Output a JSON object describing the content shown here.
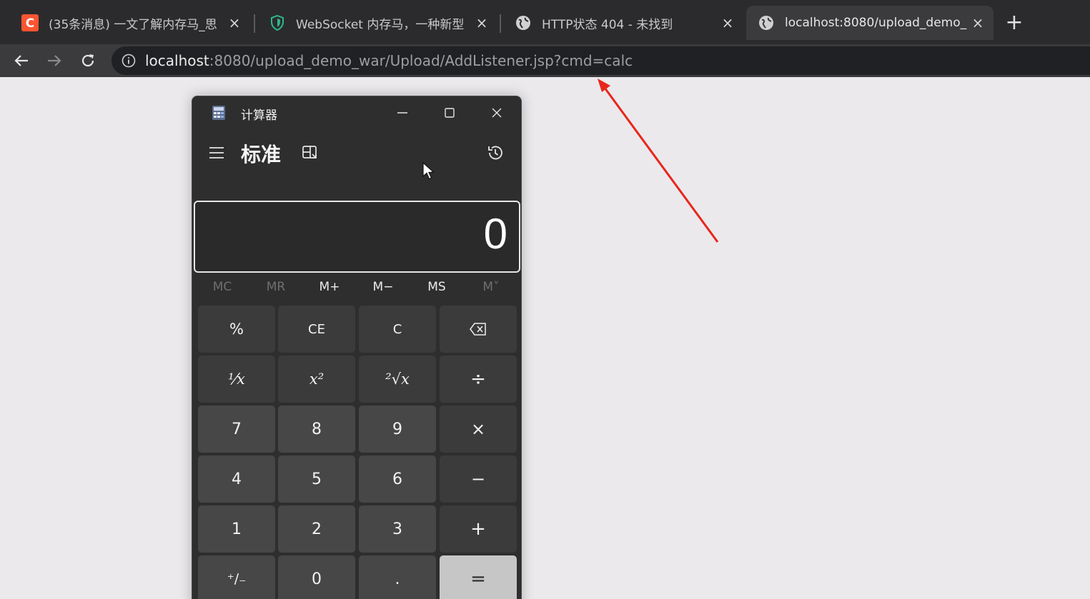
{
  "browser": {
    "tabs": [
      {
        "title": "(35条消息) 一文了解内存马_思",
        "icon": "csdn-icon"
      },
      {
        "title": "WebSocket 内存马，一种新型",
        "icon": "shield-icon"
      },
      {
        "title": "HTTP状态 404 - 未找到",
        "icon": "globe-icon"
      },
      {
        "title": "localhost:8080/upload_demo_",
        "icon": "globe-icon",
        "active": true
      }
    ],
    "close_glyph": "×",
    "new_tab_glyph": "+",
    "url_host": "localhost",
    "url_rest": ":8080/upload_demo_war/Upload/AddListener.jsp?cmd=calc"
  },
  "calculator": {
    "window_title": "计算器",
    "mode_title": "标准",
    "display_value": "0",
    "memory_keys": [
      {
        "label": "MC",
        "enabled": false
      },
      {
        "label": "MR",
        "enabled": false
      },
      {
        "label": "M+",
        "enabled": true
      },
      {
        "label": "M−",
        "enabled": true
      },
      {
        "label": "MS",
        "enabled": true
      },
      {
        "label": "M˅",
        "enabled": false
      }
    ],
    "keys": {
      "percent": "%",
      "ce": "CE",
      "c": "C",
      "backspace": "⌫",
      "reciprocal": "⅟x",
      "square": "x²",
      "sqrt": "²√x",
      "divide": "÷",
      "seven": "7",
      "eight": "8",
      "nine": "9",
      "multiply": "×",
      "four": "4",
      "five": "5",
      "six": "6",
      "minus": "−",
      "one": "1",
      "two": "2",
      "three": "3",
      "plus": "+",
      "negate": "⁺∕₋",
      "zero": "0",
      "decimal": ".",
      "equals": "="
    }
  },
  "colors": {
    "annotation_arrow": "#e8261c",
    "page_background": "#ebe9ec",
    "calc_background": "#2e2e2f"
  }
}
